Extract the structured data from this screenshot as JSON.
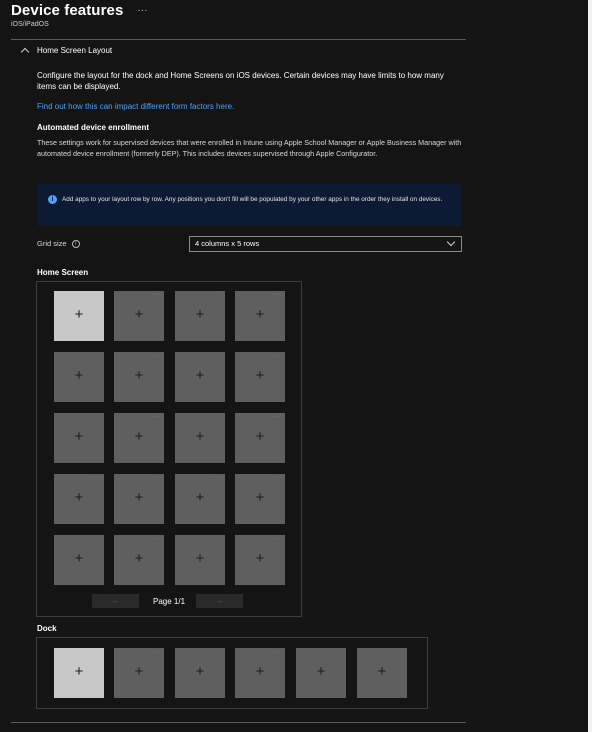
{
  "header": {
    "title": "Device features",
    "more_label": "···",
    "subtitle": "iOS/iPadOS"
  },
  "section": {
    "title": "Home Screen Layout",
    "description": "Configure the layout for the dock and Home Screens on iOS devices. Certain devices may have limits to how many items can be displayed.",
    "link_text": "Find out how this can impact different form factors here.",
    "ade_title": "Automated device enrollment",
    "ade_description": "These settings work for supervised devices that were enrolled in Intune using Apple School Manager or Apple Business Manager with automated device enrollment (formerly DEP). This includes devices supervised through Apple Configurator."
  },
  "info_banner": {
    "icon": "info-icon",
    "icon_glyph": "i",
    "text": "Add apps to your layout row by row. Any positions you don't fill will be populated by your other apps in the order they install on devices."
  },
  "grid_size": {
    "label": "Grid size",
    "info_glyph": "i",
    "selected": "4 columns x 5 rows"
  },
  "home_screen": {
    "label": "Home Screen",
    "columns": 4,
    "rows": 5,
    "tile_glyph": "+",
    "tile_dots": "···",
    "page_label": "Page 1/1",
    "prev_glyph": "←",
    "next_glyph": "→"
  },
  "dock": {
    "label": "Dock",
    "slots": 6
  },
  "colors": {
    "background": "#141414",
    "link": "#4da3ff",
    "info_banner_bg": "#0c1a33",
    "tile": "#5f5f5f",
    "tile_selected": "#c8c8c8"
  }
}
